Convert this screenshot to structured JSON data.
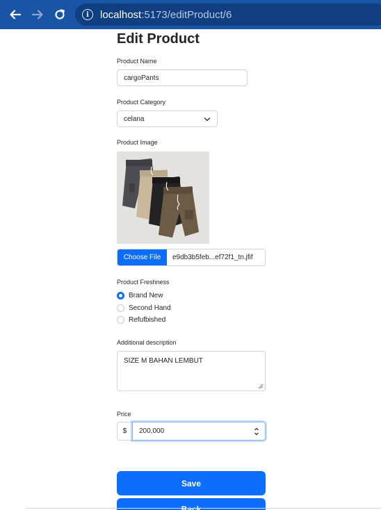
{
  "browser": {
    "url_host": "localhost",
    "url_path": ":5173/editProduct/6"
  },
  "page": {
    "title": "Edit Product"
  },
  "form": {
    "name_label": "Product Name",
    "name_value": "cargoPants",
    "category_label": "Product Category",
    "category_value": "celana",
    "image_label": "Product Image",
    "choose_file_label": "Choose File",
    "file_name": "e9db3b5feb...ef72f1_tn.jfif",
    "freshness_label": "Product Freshness",
    "freshness_options": [
      "Brand New",
      "Second Hand",
      "Refufbished"
    ],
    "freshness_selected": "Brand New",
    "description_label": "Additional description",
    "description_value": "SIZE M BAHAN LEMBUT",
    "price_label": "Price",
    "price_prefix": "$",
    "price_value": "200,000",
    "save_label": "Save",
    "back_label": "Back"
  },
  "colors": {
    "browser_bar": "#1a55a5",
    "primary": "#0d6efd"
  }
}
